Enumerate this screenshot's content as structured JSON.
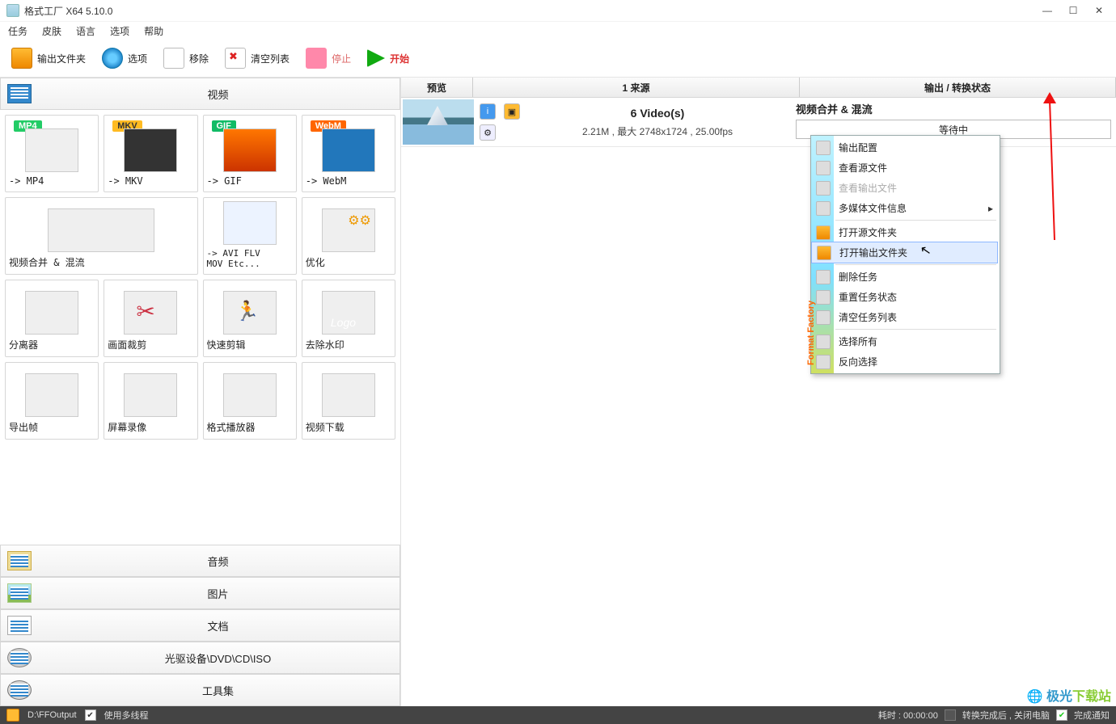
{
  "title": "格式工厂 X64 5.10.0",
  "menu": {
    "task": "任务",
    "skin": "皮肤",
    "lang": "语言",
    "opt": "选项",
    "help": "帮助"
  },
  "toolbar": {
    "out": "输出文件夹",
    "opt": "选项",
    "remove": "移除",
    "clear": "清空列表",
    "stop": "停止",
    "start": "开始"
  },
  "categories": {
    "video": "视频",
    "audio": "音频",
    "pic": "图片",
    "doc": "文档",
    "dvd": "光驱设备\\DVD\\CD\\ISO",
    "tool": "工具集"
  },
  "tiles": {
    "mp4": {
      "badge": "MP4",
      "label": "-> MP4"
    },
    "mkv": {
      "badge": "MKV",
      "label": "-> MKV"
    },
    "gif": {
      "badge": "GIF",
      "label": "-> GIF"
    },
    "webm": {
      "badge": "WebM",
      "label": "-> WebM"
    },
    "merge": {
      "label": "视频合并 & 混流"
    },
    "avi": {
      "label": "-> AVI FLV\nMOV Etc..."
    },
    "opt": {
      "label": "优化"
    },
    "split": {
      "label": "分离器"
    },
    "crop": {
      "label": "画面裁剪"
    },
    "cut": {
      "label": "快速剪辑"
    },
    "logo": {
      "label": "去除水印"
    },
    "export": {
      "label": "导出帧"
    },
    "rec": {
      "label": "屏幕录像"
    },
    "player": {
      "label": "格式播放器"
    },
    "dl": {
      "label": "视频下载"
    }
  },
  "headers": {
    "preview": "预览",
    "source": "1 来源",
    "output": "输出 / 转换状态"
  },
  "row": {
    "videos": "6 Video(s)",
    "detail": "2.21M , 最大 2748x1724 , 25.00fps",
    "outTitle": "视频合并 & 混流",
    "status": "等待中"
  },
  "ctx": {
    "brand": "Format Factory",
    "cfg": "输出配置",
    "viewSrc": "查看源文件",
    "viewOut": "查看输出文件",
    "media": "多媒体文件信息",
    "openSrc": "打开源文件夹",
    "openOut": "打开输出文件夹",
    "del": "删除任务",
    "reset": "重置任务状态",
    "clear": "清空任务列表",
    "selAll": "选择所有",
    "inv": "反向选择"
  },
  "status": {
    "path": "D:\\FFOutput",
    "multi": "使用多线程",
    "time": "耗时 : 00:00:00",
    "after": "转换完成后 , 关闭电脑",
    "notify": "完成通知"
  },
  "wm": {
    "a": "极光",
    "b": "下载站"
  }
}
